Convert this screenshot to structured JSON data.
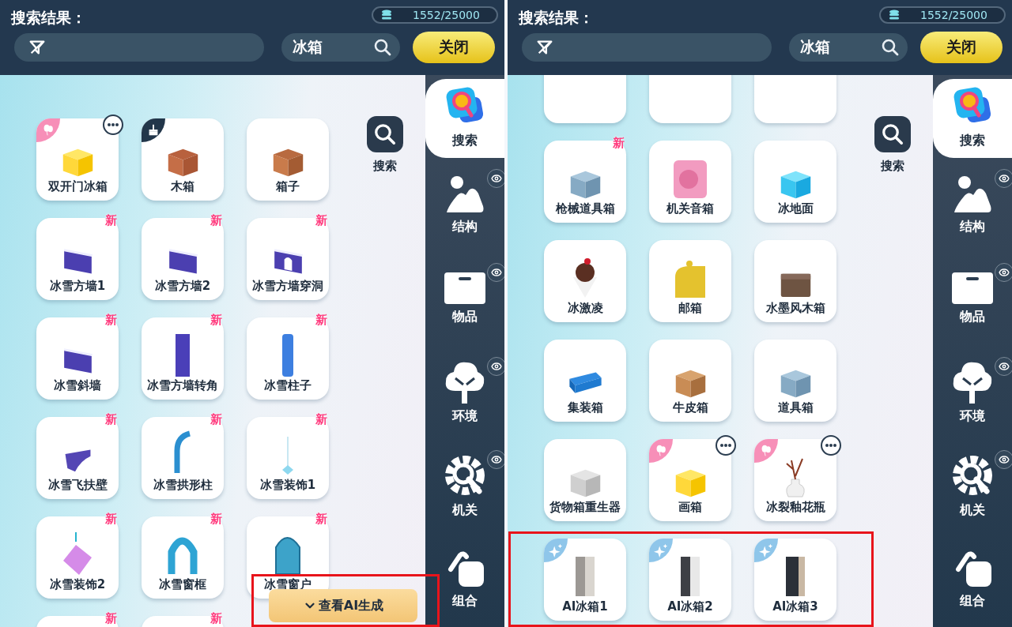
{
  "panels": [
    {
      "title": "搜索结果：",
      "balance": "1552/25000",
      "search_value": "冰箱",
      "close_label": "关闭",
      "search_button_label": "搜索",
      "scrolled": false,
      "highlight_ai_button": true,
      "ai_button": "查看AI生成",
      "tabs": [
        {
          "label": "搜索",
          "kind": "search",
          "selected": true,
          "visibility_toggle": false
        },
        {
          "label": "结构",
          "kind": "structure",
          "selected": false,
          "visibility_toggle": true
        },
        {
          "label": "物品",
          "kind": "object",
          "selected": false,
          "visibility_toggle": true
        },
        {
          "label": "环境",
          "kind": "environment",
          "selected": false,
          "visibility_toggle": true
        },
        {
          "label": "机关",
          "kind": "mechanism",
          "selected": false,
          "visibility_toggle": true
        },
        {
          "label": "组合",
          "kind": "combo",
          "selected": false,
          "visibility_toggle": false
        }
      ],
      "items": [
        {
          "label": "双开门冰箱",
          "kind": "mystery",
          "balloon": true,
          "more": true
        },
        {
          "label": "木箱",
          "kind": "crate",
          "tool": true
        },
        {
          "label": "箱子",
          "kind": "crate2"
        },
        {
          "label": "冰雪方墙1",
          "kind": "wall",
          "tag": "新"
        },
        {
          "label": "冰雪方墙2",
          "kind": "wall",
          "tag": "新"
        },
        {
          "label": "冰雪方墙穿洞",
          "kind": "wall-hole",
          "tag": "新"
        },
        {
          "label": "冰雪斜墙",
          "kind": "wall",
          "tag": "新"
        },
        {
          "label": "冰雪方墙转角",
          "kind": "pillar",
          "tag": "新"
        },
        {
          "label": "冰雪柱子",
          "kind": "pillar2",
          "tag": "新"
        },
        {
          "label": "冰雪飞扶壁",
          "kind": "buttress",
          "tag": "新"
        },
        {
          "label": "冰雪拱形柱",
          "kind": "arc",
          "tag": "新"
        },
        {
          "label": "冰雪装饰1",
          "kind": "ornament",
          "tag": "新"
        },
        {
          "label": "冰雪装饰2",
          "kind": "ornament2",
          "tag": "新"
        },
        {
          "label": "冰雪窗框",
          "kind": "arch",
          "tag": "新"
        },
        {
          "label": "冰雪窗户",
          "kind": "window",
          "tag": "新"
        },
        {
          "kind": "none",
          "tag": "新"
        },
        {
          "kind": "none",
          "tag": "新"
        }
      ]
    },
    {
      "title": "搜索结果：",
      "balance": "1552/25000",
      "search_value": "冰箱",
      "close_label": "关闭",
      "search_button_label": "搜索",
      "scrolled": true,
      "highlight_ai_row": true,
      "tabs": [
        {
          "label": "搜索",
          "kind": "search",
          "selected": true,
          "visibility_toggle": false
        },
        {
          "label": "结构",
          "kind": "structure",
          "selected": false,
          "visibility_toggle": true
        },
        {
          "label": "物品",
          "kind": "object",
          "selected": false,
          "visibility_toggle": true
        },
        {
          "label": "环境",
          "kind": "environment",
          "selected": false,
          "visibility_toggle": true
        },
        {
          "label": "机关",
          "kind": "mechanism",
          "selected": false,
          "visibility_toggle": true
        },
        {
          "label": "组合",
          "kind": "combo",
          "selected": false,
          "visibility_toggle": false
        }
      ],
      "items": [
        {
          "kind": "none"
        },
        {
          "kind": "none"
        },
        {
          "kind": "none"
        },
        {
          "label": "枪械道具箱",
          "kind": "propbox",
          "tag": "新"
        },
        {
          "label": "机关音箱",
          "kind": "speaker"
        },
        {
          "label": "冰地面",
          "kind": "ice"
        },
        {
          "label": "冰激凌",
          "kind": "sundae"
        },
        {
          "label": "邮箱",
          "kind": "mailbox"
        },
        {
          "label": "水墨风木箱",
          "kind": "chest"
        },
        {
          "label": "集装箱",
          "kind": "container"
        },
        {
          "label": "牛皮箱",
          "kind": "parcel"
        },
        {
          "label": "道具箱",
          "kind": "propbox"
        },
        {
          "label": "货物箱重生器",
          "kind": "regen"
        },
        {
          "label": "画箱",
          "kind": "mystery",
          "balloon": true,
          "more": true
        },
        {
          "label": "冰裂釉花瓶",
          "kind": "vase",
          "balloon": true,
          "more": true
        },
        {
          "label": "AI冰箱1",
          "kind": "fridge",
          "sparkle": true
        },
        {
          "label": "AI冰箱2",
          "kind": "fridge2",
          "sparkle": true
        },
        {
          "label": "AI冰箱3",
          "kind": "fridge3",
          "sparkle": true
        }
      ]
    }
  ]
}
